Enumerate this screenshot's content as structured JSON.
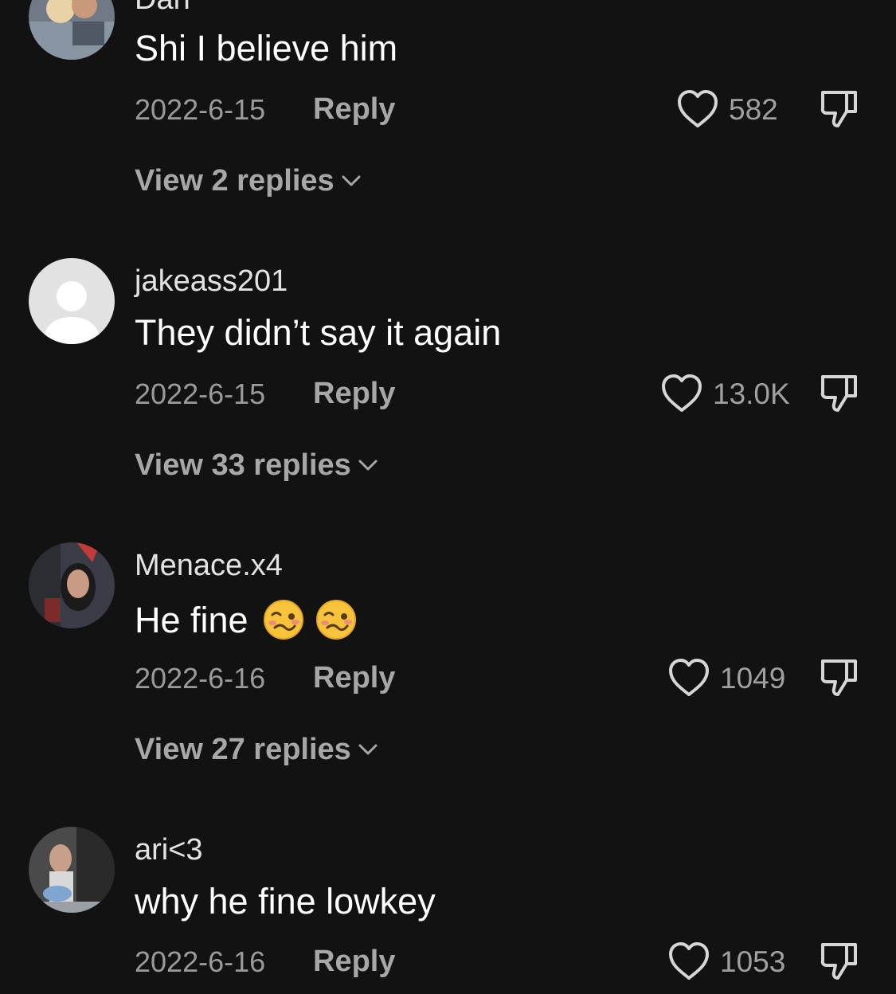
{
  "comments": [
    {
      "username": "Dan",
      "text": "Shi I believe him",
      "date": "2022-6-15",
      "reply_label": "Reply",
      "likes": "582",
      "view_replies": "View 2 replies"
    },
    {
      "username": "jakeass201",
      "text": "They didn’t say it again",
      "date": "2022-6-15",
      "reply_label": "Reply",
      "likes": "13.0K",
      "view_replies": "View 33 replies"
    },
    {
      "username": "Menace.x4",
      "text": "He fine",
      "emojis": [
        "woozy-face",
        "woozy-face"
      ],
      "date": "2022-6-16",
      "reply_label": "Reply",
      "likes": "1049",
      "view_replies": "View 27 replies"
    },
    {
      "username": "ari<3",
      "text": "why he fine lowkey",
      "date": "2022-6-16",
      "reply_label": "Reply",
      "likes": "1053"
    }
  ],
  "icons": {
    "like": "heart-outline-icon",
    "dislike": "thumbs-down-icon",
    "expand": "chevron-down-icon"
  },
  "colors": {
    "background": "#121212",
    "text_primary": "#ffffff",
    "text_secondary": "#a7a7a7"
  }
}
